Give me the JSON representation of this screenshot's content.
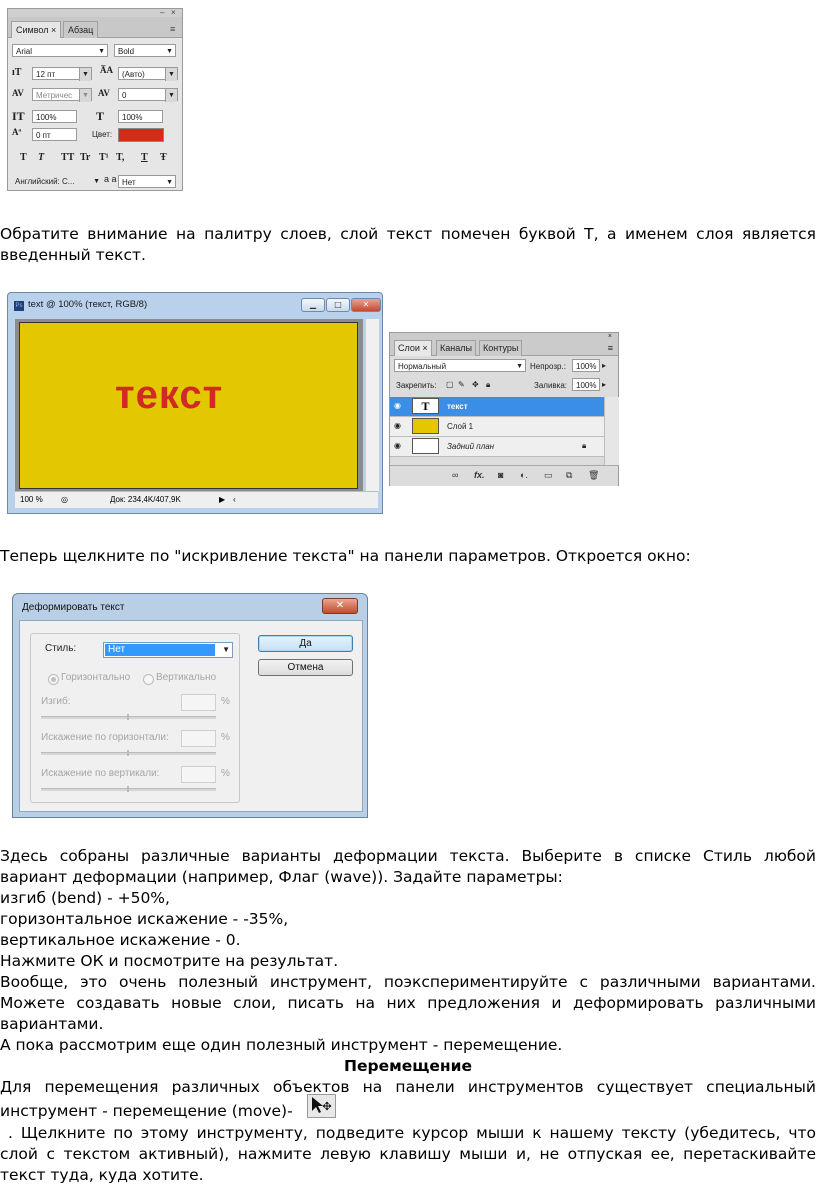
{
  "char_palette": {
    "tabs": [
      "Символ ×",
      "Абзац"
    ],
    "font_family": "Arial",
    "font_style": "Bold",
    "size": "12 пт",
    "leading": "(Авто)",
    "kerning": "Метричес",
    "tracking": "0",
    "vscale": "100%",
    "hscale": "100%",
    "baseline": "0 пт",
    "color_label": "Цвет:",
    "language": "Английский: С...",
    "antialias_label": "a a",
    "antialias": "Нет",
    "format_buttons": [
      "T",
      "T",
      "TT",
      "Tr",
      "T¹",
      "T,",
      "T",
      "Ŧ"
    ],
    "colors": {
      "text_color": "#d42b1b"
    }
  },
  "paragraph1": "Обратите внимание на палитру слоев, слой текст помечен буквой Т, а именем слоя является введенный текст.",
  "doc_window": {
    "title": "text @ 100% (текст, RGB/8)",
    "canvas_text": "текст",
    "zoom": "100 %",
    "doc_info": "Док: 234,4K/407,9K"
  },
  "layers_panel": {
    "tabs": [
      "Слои ×",
      "Каналы",
      "Контуры"
    ],
    "blend_mode": "Нормальный",
    "opacity_label": "Непрозр.:",
    "opacity": "100%",
    "lock_label": "Закрепить:",
    "fill_label": "Заливка:",
    "fill": "100%",
    "layers": [
      {
        "name": "текст",
        "thumb": "T"
      },
      {
        "name": "Слой 1",
        "thumb": ""
      },
      {
        "name": "Задний план",
        "thumb": ""
      }
    ],
    "footer_icons": [
      "link-icon",
      "fx-icon",
      "mask-icon",
      "adjustment-icon",
      "folder-icon",
      "new-layer-icon",
      "trash-icon"
    ]
  },
  "paragraph2": "Теперь щелкните по \"искривление текста\" на панели параметров. Откроется окно:",
  "warp_dialog": {
    "title": "Деформировать текст",
    "style_label": "Стиль:",
    "style_value": "Нет",
    "ok": "Да",
    "cancel": "Отмена",
    "horizontal": "Горизонтально",
    "vertical": "Вертикально",
    "bend_label": "Изгиб:",
    "hdist_label": "Искажение по горизонтали:",
    "vdist_label": "Искажение по вертикали:",
    "percent": "%"
  },
  "body_text": {
    "p3": "Здесь собраны различные варианты деформации текста. Выберите в списке Стиль любой вариант деформации (например, Флаг (wave)). Задайте параметры:",
    "l1": "изгиб (bend) - +50%,",
    "l2": "горизонтальное искажение - -35%,",
    "l3": "вертикальное искажение - 0.",
    "l4": "Нажмите ОК и посмотрите на результат.",
    "p4": "Вообще, это очень полезный инструмент, поэкспериментируйте с различными вариантами. Можете создавать новые слои, писать на них предложения и деформировать различными вариантами.",
    "p5": "А пока рассмотрим еще один полезный инструмент - перемещение.",
    "heading": "Перемещение",
    "p6a": "Для перемещения различных объектов на панели инструментов существует специальный",
    "p6b": "инструмент - перемещение (move)-",
    "p7": ". Щелкните по этому инструменту, подведите курсор мыши к нашему тексту (убедитесь, что слой с текстом активный), нажмите левую клавишу мыши и, не отпуская ее, перетаскивайте текст туда, куда хотите."
  }
}
